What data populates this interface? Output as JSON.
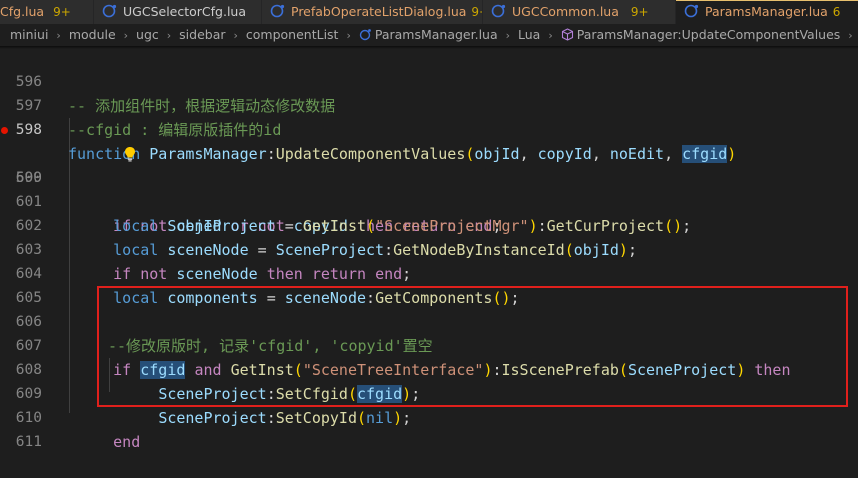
{
  "tabs": [
    {
      "name": "Cfg.lua",
      "badge": "9+",
      "icon": "lua-file-icon",
      "active": false
    },
    {
      "name": "UGCSelectorCfg.lua",
      "badge": "",
      "icon": "lua-file-icon",
      "active": false
    },
    {
      "name": "PrefabOperateListDialog.lua",
      "badge": "9+",
      "icon": "lua-file-icon",
      "active": false
    },
    {
      "name": "UGCCommon.lua",
      "badge": "9+",
      "icon": "lua-file-icon",
      "active": false
    },
    {
      "name": "ParamsManager.lua",
      "badge": "6",
      "icon": "lua-file-icon",
      "active": true
    }
  ],
  "breadcrumb": {
    "items": [
      "miniui",
      "module",
      "ugc",
      "sidebar",
      "componentList",
      "ParamsManager.lua",
      "Lua",
      "ParamsManager:UpdateComponentValues",
      "cfgid"
    ],
    "separator": "›"
  },
  "editor": {
    "lines": [
      {
        "num": "596",
        "code": "-- 添加组件时，根据逻辑动态修改数据"
      },
      {
        "num": "597",
        "code": "--cfgid : 编辑原版插件的id"
      },
      {
        "num": "598",
        "code": "function ParamsManager:UpdateComponentValues(objId, copyId, noEdit, cfgid)"
      },
      {
        "num": "599",
        "code": "if not objId or not copyId then return end;"
      },
      {
        "num": "600",
        "code": ""
      },
      {
        "num": "601",
        "code": "local SceneProject = GetInst(\"SceneProjectMgr\"):GetCurProject();"
      },
      {
        "num": "602",
        "code": "local sceneNode = SceneProject:GetNodeByInstanceId(objId);"
      },
      {
        "num": "603",
        "code": "if not sceneNode then return end;"
      },
      {
        "num": "604",
        "code": "local components = sceneNode:GetComponents();"
      },
      {
        "num": "605",
        "code": ""
      },
      {
        "num": "606",
        "code": "--修改原版时, 记录'cfgid', 'copyid'置空"
      },
      {
        "num": "607",
        "code": "if cfgid and GetInst(\"SceneTreeInterface\"):IsScenePrefab(SceneProject) then"
      },
      {
        "num": "608",
        "code": "SceneProject:SetCfgid(cfgid);"
      },
      {
        "num": "609",
        "code": "SceneProject:SetCopyId(nil);"
      },
      {
        "num": "610",
        "code": "end"
      },
      {
        "num": "611",
        "code": ""
      }
    ]
  },
  "colors": {
    "background": "#1e1e1e",
    "comment": "#6a9955",
    "keyword": "#569cd6",
    "control": "#c586c0",
    "function": "#dcdcaa",
    "variable": "#9cdcfe",
    "string": "#ce9178",
    "annotation_box": "#e0201c",
    "breakpoint": "#e51400"
  }
}
